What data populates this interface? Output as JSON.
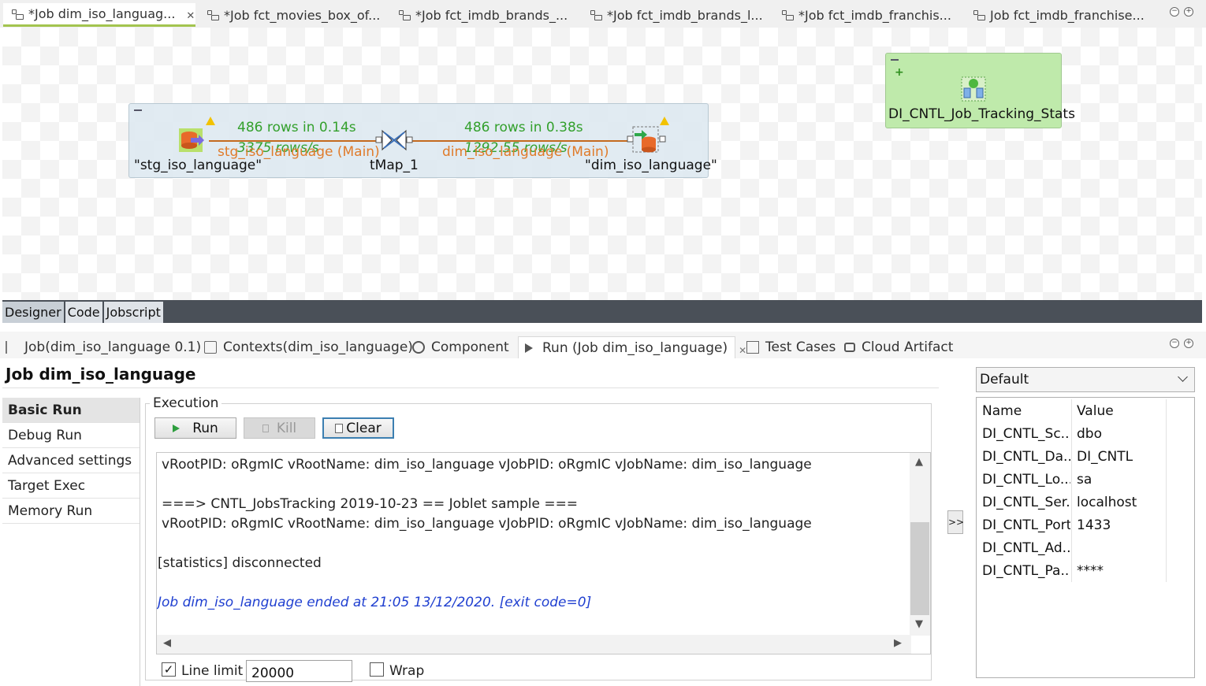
{
  "editor_tabs": [
    {
      "label": "*Job dim_iso_languag...",
      "active": true
    },
    {
      "label": "*Job fct_movies_box_of..."
    },
    {
      "label": "*Job fct_imdb_brands_..."
    },
    {
      "label": "*Job fct_imdb_brands_l..."
    },
    {
      "label": "*Job fct_imdb_franchis..."
    },
    {
      "label": "Job fct_imdb_franchise..."
    }
  ],
  "designer": {
    "source_label": "\"stg_iso_language\"",
    "tmap_label": "tMap_1",
    "target_label": "\"dim_iso_language\"",
    "flow1_rows": "486 rows in 0.14s",
    "flow1_rate": "3375 rows/s",
    "flow1_name": "stg_iso_language (Main)",
    "flow2_rows": "486 rows in 0.38s",
    "flow2_rate": "1292.55 rows/s",
    "flow2_name": "dim_iso_language (Main)",
    "tracking_label": "DI_CNTL_Job_Tracking_Stats"
  },
  "designer_tabs": [
    "Designer",
    "Code",
    "Jobscript"
  ],
  "panel_tabs": [
    {
      "label": "Job(dim_iso_language 0.1)"
    },
    {
      "label": "Contexts(dim_iso_language)"
    },
    {
      "label": "Component"
    },
    {
      "label": "Run (Job dim_iso_language)",
      "active": true
    },
    {
      "label": "Test Cases"
    },
    {
      "label": "Cloud Artifact"
    }
  ],
  "run": {
    "title": "Job dim_iso_language",
    "nav": [
      "Basic Run",
      "Debug Run",
      "Advanced settings",
      "Target Exec",
      "Memory Run"
    ],
    "execution_label": "Execution",
    "run_label": "Run",
    "kill_label": "Kill",
    "clear_label": "Clear",
    "console_lines": [
      "vRootPID: oRgmIC vRootName: dim_iso_language vJobPID: oRgmIC vJobName: dim_iso_language",
      "===> CNTL_JobsTracking 2019-10-23 == Joblet sample ===",
      "vRootPID: oRgmIC vRootName: dim_iso_language vJobPID: oRgmIC vJobName: dim_iso_language",
      "[statistics] disconnected",
      "Job dim_iso_language ended at 21:05 13/12/2020. [exit code=0]"
    ],
    "line_limit_label": "Line limit",
    "line_limit_value": "20000",
    "wrap_label": "Wrap",
    "expand_label": ">>"
  },
  "context": {
    "selected": "Default",
    "headers": {
      "name": "Name",
      "value": "Value"
    },
    "rows": [
      {
        "name": "DI_CNTL_Sc...",
        "value": "dbo"
      },
      {
        "name": "DI_CNTL_Da...",
        "value": "DI_CNTL"
      },
      {
        "name": "DI_CNTL_Lo...",
        "value": "sa"
      },
      {
        "name": "DI_CNTL_Ser...",
        "value": "localhost"
      },
      {
        "name": "DI_CNTL_Port",
        "value": "1433"
      },
      {
        "name": "DI_CNTL_Ad...",
        "value": ""
      },
      {
        "name": "DI_CNTL_Pa...",
        "value": "****"
      }
    ]
  }
}
